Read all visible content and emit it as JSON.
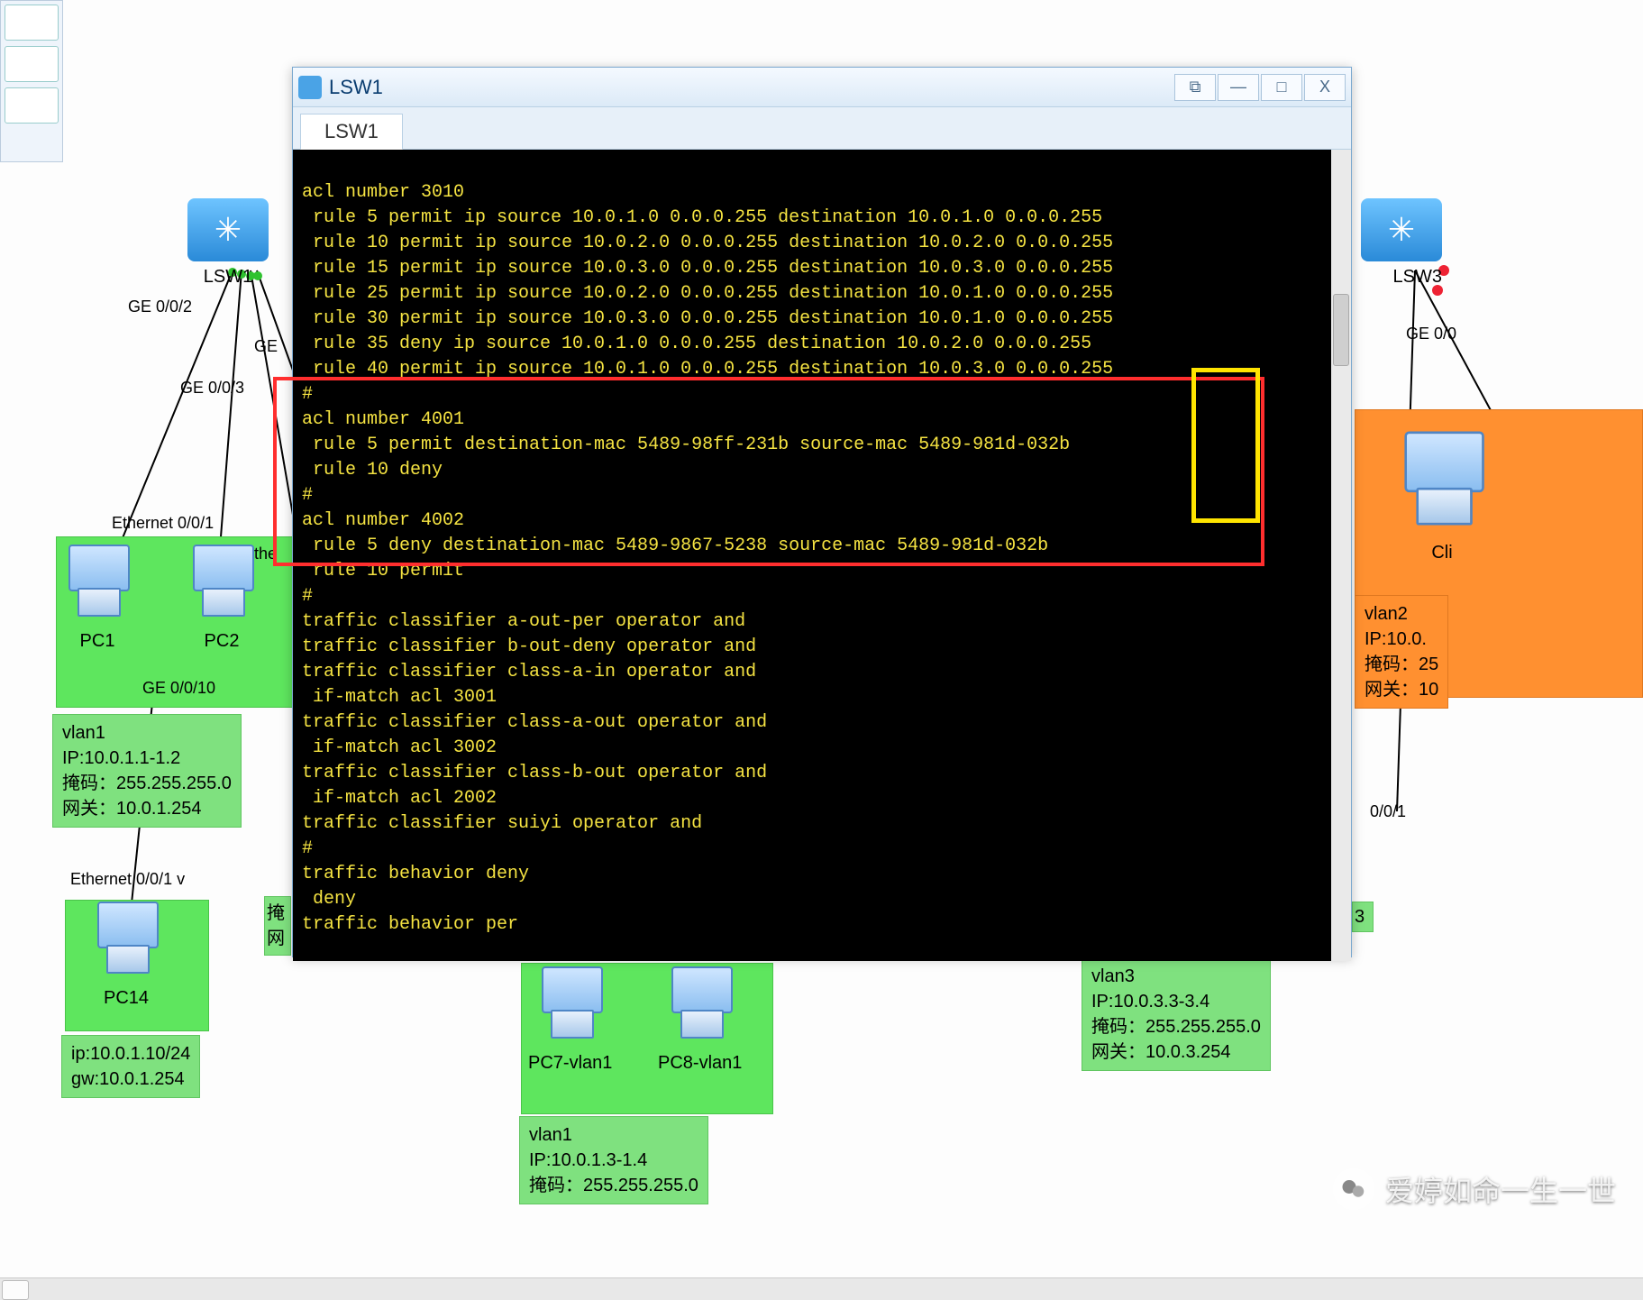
{
  "window": {
    "title": "LSW1",
    "tab": "LSW1",
    "buttons": {
      "dock": "⧉",
      "min": "—",
      "max": "□",
      "close": "X"
    }
  },
  "terminal": {
    "lines": [
      "acl number 3010",
      " rule 5 permit ip source 10.0.1.0 0.0.0.255 destination 10.0.1.0 0.0.0.255",
      " rule 10 permit ip source 10.0.2.0 0.0.0.255 destination 10.0.2.0 0.0.0.255",
      " rule 15 permit ip source 10.0.3.0 0.0.0.255 destination 10.0.3.0 0.0.0.255",
      " rule 25 permit ip source 10.0.2.0 0.0.0.255 destination 10.0.1.0 0.0.0.255",
      " rule 30 permit ip source 10.0.3.0 0.0.0.255 destination 10.0.1.0 0.0.0.255",
      " rule 35 deny ip source 10.0.1.0 0.0.0.255 destination 10.0.2.0 0.0.0.255",
      " rule 40 permit ip source 10.0.1.0 0.0.0.255 destination 10.0.3.0 0.0.0.255",
      "#",
      "acl number 4001",
      " rule 5 permit destination-mac 5489-98ff-231b source-mac 5489-981d-032b",
      " rule 10 deny",
      "#",
      "acl number 4002",
      " rule 5 deny destination-mac 5489-9867-5238 source-mac 5489-981d-032b",
      " rule 10 permit",
      "#",
      "traffic classifier a-out-per operator and",
      "traffic classifier b-out-deny operator and",
      "traffic classifier class-a-in operator and",
      " if-match acl 3001",
      "traffic classifier class-a-out operator and",
      " if-match acl 3002",
      "traffic classifier class-b-out operator and",
      " if-match acl 2002",
      "traffic classifier suiyi operator and",
      "#",
      "traffic behavior deny",
      " deny",
      "traffic behavior per"
    ]
  },
  "topology": {
    "switches": {
      "lsw1": "LSW1",
      "lsw3": "LSW3"
    },
    "ports": {
      "ge002": "GE 0/0/2",
      "ge003": "GE 0/0/3",
      "ge0010": "GE 0/0/10",
      "ge00x": "GE 0/0",
      "ge_frag": "GE",
      "eth001_a": "Ethernet 0/0/1",
      "eth001_b": "Ethernet 0/0/1 v",
      "eth_frag": "Ethe",
      "port001": "0/0/1"
    },
    "pcs": {
      "pc1": "PC1",
      "pc2": "PC2",
      "pc14": "PC14",
      "pc7": "PC7-vlan1",
      "pc8": "PC8-vlan1",
      "cli": "Cli"
    },
    "info_vlan1": {
      "l1": "vlan1",
      "l2": "IP:10.0.1.1-1.2",
      "l3": "掩码：255.255.255.0",
      "l4": "网关：10.0.1.254"
    },
    "info_pc14": {
      "l1": "ip:10.0.1.10/24",
      "l2": "gw:10.0.1.254"
    },
    "info_vlan1b": {
      "l1": "vlan1",
      "l2": "IP:10.0.1.3-1.4",
      "l3": "掩码：255.255.255.0"
    },
    "info_vlan3": {
      "l1": "vlan3",
      "l2": "IP:10.0.3.3-3.4",
      "l3": "掩码：255.255.255.0",
      "l4": "网关：10.0.3.254"
    },
    "info_vlan2": {
      "l1": "vlan2",
      "l2": "IP:10.0.",
      "l3": "掩码：25",
      "l4": "网关：10"
    },
    "partial_info": {
      "l1": "掩",
      "l2": "网"
    },
    "frag3": "3"
  },
  "watermark": "爱婷如命一生一世"
}
